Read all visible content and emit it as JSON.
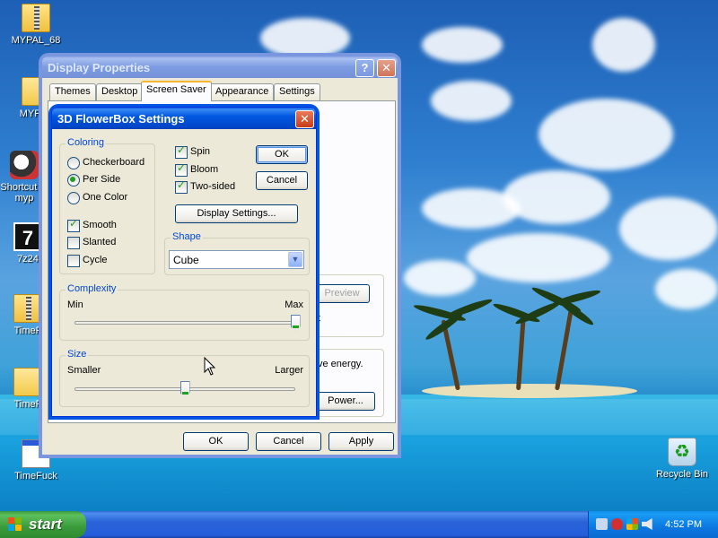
{
  "desktop": {
    "icons": [
      {
        "label": "MYPAL_68",
        "icon": "zip-folder-icon"
      },
      {
        "label": "MYPAL",
        "icon": "folder-icon"
      },
      {
        "label": "Shortcut to myp",
        "icon": "shortcut-icon"
      },
      {
        "label": "7z24",
        "icon": "7zip-icon"
      },
      {
        "label": "TimeF",
        "icon": "zip-folder-icon"
      },
      {
        "label": "TimeF",
        "icon": "folder-icon"
      },
      {
        "label": "TimeFuck",
        "icon": "file-icon"
      },
      {
        "label": "Recycle Bin",
        "icon": "recycle-bin-icon"
      }
    ]
  },
  "display_properties": {
    "title": "Display Properties",
    "tabs": [
      "Themes",
      "Desktop",
      "Screen Saver",
      "Appearance",
      "Settings"
    ],
    "active_tab": "Screen Saver",
    "partial_preview_label": "Preview",
    "partial_t_label": "t",
    "partial_energy_text": "ve energy.",
    "partial_power_label": "Power...",
    "ok_label": "OK",
    "cancel_label": "Cancel",
    "apply_label": "Apply"
  },
  "flowerbox": {
    "title": "3D FlowerBox Settings",
    "coloring": {
      "title": "Coloring",
      "options": [
        "Checkerboard",
        "Per Side",
        "One Color"
      ],
      "selected": "Per Side"
    },
    "checks_left": [
      {
        "label": "Smooth",
        "checked": true
      },
      {
        "label": "Slanted",
        "checked": false
      },
      {
        "label": "Cycle",
        "checked": false
      }
    ],
    "checks_right": [
      {
        "label": "Spin",
        "checked": true
      },
      {
        "label": "Bloom",
        "checked": true
      },
      {
        "label": "Two-sided",
        "checked": true
      }
    ],
    "ok_label": "OK",
    "cancel_label": "Cancel",
    "display_settings_label": "Display Settings...",
    "shape": {
      "title": "Shape",
      "value": "Cube"
    },
    "complexity": {
      "title": "Complexity",
      "min_label": "Min",
      "max_label": "Max",
      "value": 1.0
    },
    "size": {
      "title": "Size",
      "min_label": "Smaller",
      "max_label": "Larger",
      "value": 0.5
    }
  },
  "taskbar": {
    "start_label": "start",
    "clock": "4:52 PM"
  },
  "colors": {
    "accent": "#0055e5",
    "group_title": "#0046d5",
    "check_green": "#21a121"
  }
}
